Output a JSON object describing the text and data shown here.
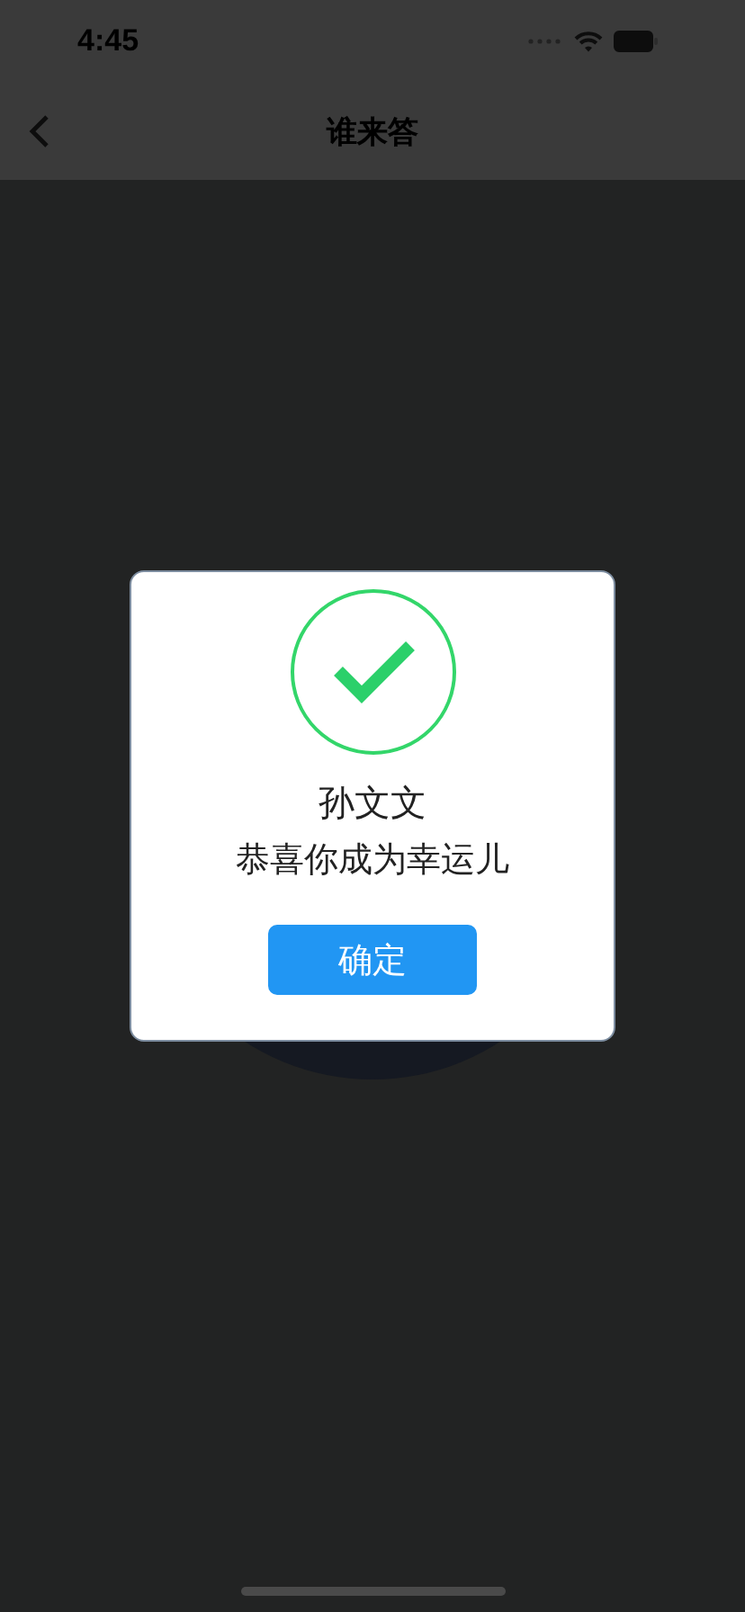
{
  "status_bar": {
    "time": "4:45"
  },
  "nav": {
    "title": "谁来答"
  },
  "dialog": {
    "kind": "success",
    "name": "孙文文",
    "message": "恭喜你成为幸运儿",
    "button": "确定"
  }
}
